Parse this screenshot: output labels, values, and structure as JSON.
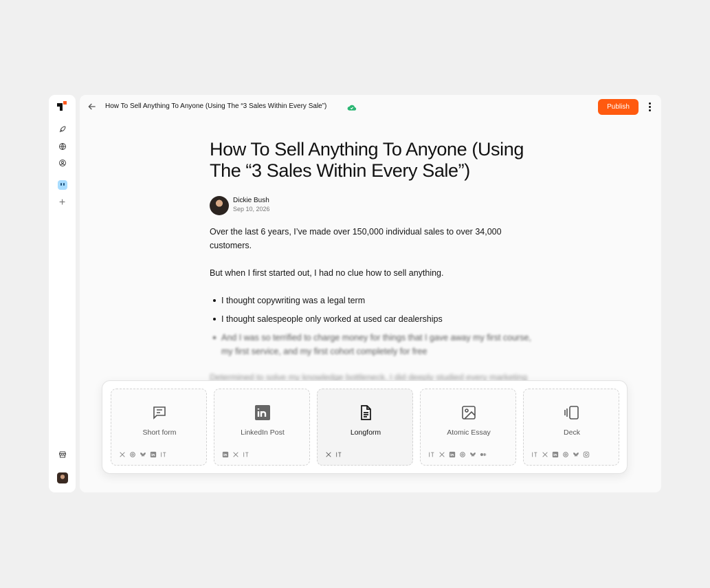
{
  "document": {
    "title": "How To Sell Anything To Anyone (Using The “3 Sales Within Every Sale”)",
    "publish_label": "Publish"
  },
  "article": {
    "heading": "How To Sell Anything To Anyone (Using The “3 Sales Within Every Sale”)",
    "author_name": "Dickie Bush",
    "date": "Sep 10, 2026",
    "paragraph1": "Over the last 6 years, I’ve made over 150,000 individual sales to over 34,000 customers.",
    "paragraph2": "But when I first started out, I had no clue how to sell anything.",
    "bullets": [
      "I thought copywriting was a legal term",
      "I thought salespeople only worked at used car dealerships",
      "And I was so terrified to charge money for things that I gave away my first course, my first service, and my first cohort completely for free"
    ],
    "paragraph3": "Determined to solve my knowledge bottleneck, I did deeply studied every marketing"
  },
  "formats": [
    {
      "label": "Short form",
      "icon": "message-square-icon",
      "platforms": [
        "x-icon",
        "threads-icon",
        "bluesky-icon",
        "linkedin-icon",
        "typefully-icon"
      ]
    },
    {
      "label": "LinkedIn Post",
      "icon": "linkedin-icon",
      "platforms": [
        "linkedin-icon",
        "x-icon",
        "typefully-icon"
      ]
    },
    {
      "label": "Longform",
      "icon": "document-icon",
      "platforms": [
        "x-icon",
        "typefully-icon"
      ],
      "active": true
    },
    {
      "label": "Atomic Essay",
      "icon": "image-icon",
      "platforms": [
        "typefully-icon",
        "x-icon",
        "linkedin-icon",
        "threads-icon",
        "bluesky-icon",
        "medium-icon"
      ]
    },
    {
      "label": "Deck",
      "icon": "slides-icon",
      "platforms": [
        "typefully-icon",
        "x-icon",
        "linkedin-icon",
        "threads-icon",
        "bluesky-icon",
        "instagram-icon"
      ]
    }
  ],
  "colors": {
    "accent": "#ff5a0f",
    "saved": "#2bb673"
  }
}
